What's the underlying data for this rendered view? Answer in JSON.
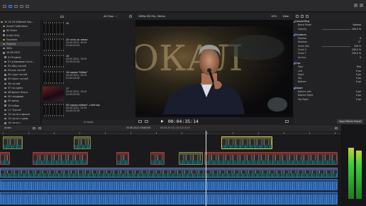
{
  "library": {
    "header": "",
    "items": [
      {
        "label": "30 04 20 Юбилей Пар...",
        "icon": "star-icon"
      },
      {
        "label": "Smart Collections",
        "icon": "folder-icon"
      },
      {
        "label": "All Video",
        "icon": "folder-icon"
      },
      {
        "label": "Audio Only",
        "icon": "folder-icon"
      },
      {
        "label": "Favorites",
        "icon": "star-icon"
      },
      {
        "label": "Projects",
        "icon": "folder-icon"
      },
      {
        "label": "Stills",
        "icon": "folder-icon"
      },
      {
        "label": "10.06.2022",
        "icon": "folder-icon"
      },
      {
        "label": "01 Projects",
        "icon": "folder-icon"
      },
      {
        "label": "01 упавшими геста...",
        "icon": "folder-icon"
      },
      {
        "label": "02 общ гостей",
        "icon": "folder-icon"
      },
      {
        "label": "03 рок гостей",
        "icon": "folder-icon"
      },
      {
        "label": "04 гуды гостей",
        "icon": "folder-icon"
      },
      {
        "label": "05 ехать гостей",
        "icon": "folder-icon"
      },
      {
        "label": "06 гостей",
        "icon": "folder-icon"
      },
      {
        "label": "07 на сцену",
        "icon": "folder-icon"
      },
      {
        "label": "08 фрагм Кед и",
        "icon": "folder-icon"
      },
      {
        "label": "09 поздравл",
        "icon": "folder-icon"
      },
      {
        "label": "09 звезд",
        "icon": "folder-icon"
      },
      {
        "label": "10 Кубик",
        "icon": "folder-icon"
      },
      {
        "label": "11 \"Кукла\"",
        "icon": "folder-icon"
      },
      {
        "label": "12 гости и фрагм",
        "icon": "folder-icon"
      },
      {
        "label": "13 гости с прим",
        "icon": "folder-icon"
      },
      {
        "label": "14 гость с",
        "icon": "folder-icon"
      }
    ]
  },
  "browser": {
    "filter": "All Clips",
    "clips": [
      {
        "name": "20",
        "date": "",
        "dur": "",
        "kind": "film"
      },
      {
        "name": "20 гость по земли",
        "date": "04.05.2022, 10:52",
        "dur": "01:00:03:00",
        "kind": "film"
      },
      {
        "name": "16",
        "date": "04.05.2022, 10:52",
        "dur": "01:00:03:00",
        "kind": "film"
      },
      {
        "name": "16 сорока \"Кубик\"",
        "date": "04.05.2022, 10:52",
        "dur": "01:00:03:00",
        "kind": "film"
      },
      {
        "name": "17",
        "date": "04.05.2022, 10:52",
        "dur": "01:00:03:00",
        "kind": "red"
      },
      {
        "name": "09 сорока кубики\", слей кор",
        "date": "04.05.2022, 10:52",
        "dur": "01:00:03:00",
        "kind": "film"
      }
    ],
    "footer": "10 items"
  },
  "viewer": {
    "title": "1080p HD 25p, Stereo",
    "zoom": "42%",
    "view": "View",
    "timecode": "00:04:35:14",
    "backdrop_text": "ОКАЛ"
  },
  "inspector": {
    "title": "",
    "rows": [
      {
        "type": "sec",
        "label": "Compositing"
      },
      {
        "label": "Blend Mode",
        "value": "Normal"
      },
      {
        "label": "Opacity",
        "value": "100.0 %",
        "slider": true
      },
      {
        "type": "sep"
      },
      {
        "type": "sec",
        "label": "Transform"
      },
      {
        "label": "Position",
        "value": "0"
      },
      {
        "label": "Rotation",
        "value": "0°"
      },
      {
        "label": "Scale (All)",
        "value": "100 %",
        "slider": true
      },
      {
        "label": "Scale X",
        "value": "100.0 %"
      },
      {
        "label": "Scale Y",
        "value": "100.0 %"
      },
      {
        "label": "Anchor",
        "value": "0"
      },
      {
        "type": "sep"
      },
      {
        "type": "sec",
        "label": "Crop"
      },
      {
        "label": "Type",
        "value": "Trim"
      },
      {
        "label": "Left",
        "value": "0 px"
      },
      {
        "label": "Right",
        "value": "0 px"
      },
      {
        "label": "Top",
        "value": "0 px"
      },
      {
        "label": "Bottom",
        "value": "0 px"
      },
      {
        "type": "sep"
      },
      {
        "type": "sec",
        "label": "Distort"
      },
      {
        "label": "Bottom Left",
        "value": "0 px"
      },
      {
        "label": "Bottom Right",
        "value": "0 px"
      },
      {
        "label": "Top Right",
        "value": "0 px"
      }
    ],
    "footer_button": "Save Effects Preset"
  },
  "timeline": {
    "index_label": "Index",
    "project_label": "30.06.2022 ЮБИЛЕЙ",
    "timecode": "00:04:35:14 / 00:12:10:07"
  },
  "colors": {
    "accent": "#3b82f6",
    "playhead": "#e5e5e5"
  }
}
